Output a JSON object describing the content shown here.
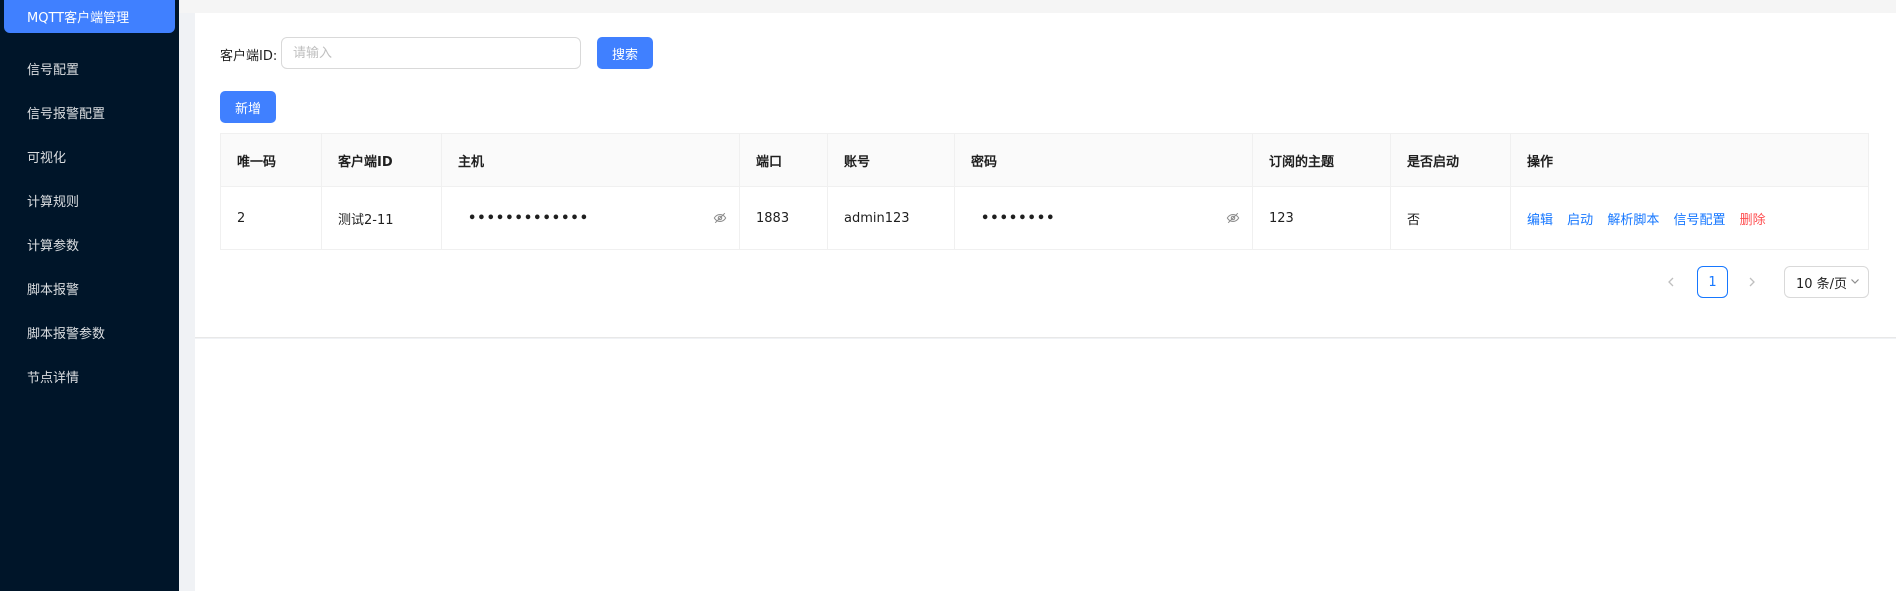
{
  "sidebar": {
    "items": [
      {
        "label": "MQTT客户端管理"
      },
      {
        "label": "信号配置"
      },
      {
        "label": "信号报警配置"
      },
      {
        "label": "可视化"
      },
      {
        "label": "计算规则"
      },
      {
        "label": "计算参数"
      },
      {
        "label": "脚本报警"
      },
      {
        "label": "脚本报警参数"
      },
      {
        "label": "节点详情"
      }
    ]
  },
  "search": {
    "label": "客户端ID:",
    "placeholder": "请输入",
    "value": "",
    "button": "搜索"
  },
  "toolbar": {
    "add_label": "新增"
  },
  "table": {
    "columns": [
      "唯一码",
      "客户端ID",
      "主机",
      "端口",
      "账号",
      "密码",
      "订阅的主题",
      "是否启动",
      "操作"
    ],
    "rows": [
      {
        "id": "2",
        "client_id": "测试2-11",
        "host": "•••••••••••••",
        "port": "1883",
        "account": "admin123",
        "password": "••••••••",
        "topic": "123",
        "enabled": "否",
        "actions": [
          "编辑",
          "启动",
          "解析脚本",
          "信号配置",
          "删除"
        ]
      }
    ]
  },
  "pagination": {
    "current": "1",
    "page_size": "10 条/页"
  },
  "colors": {
    "sidebar_bg": "#001529",
    "accent": "#4080ff",
    "link": "#1677ff",
    "danger": "#ff4d4f"
  }
}
